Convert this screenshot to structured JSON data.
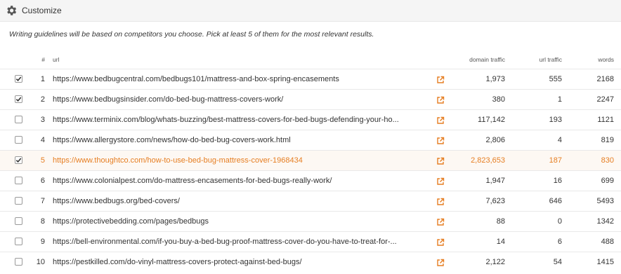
{
  "header": {
    "title": "Customize",
    "icon": "gear-icon"
  },
  "guideline": "Writing guidelines will be based on competitors you choose. Pick at least 5 of them for the most relevant results.",
  "columns": {
    "num": "#",
    "url": "url",
    "domain_traffic": "domain traffic",
    "url_traffic": "url traffic",
    "words": "words"
  },
  "accent_color": "#e67e22",
  "rows": [
    {
      "checked": true,
      "selected": false,
      "num": "1",
      "url": "https://www.bedbugcentral.com/bedbugs101/mattress-and-box-spring-encasements",
      "domain_traffic": "1,973",
      "url_traffic": "555",
      "words": "2168"
    },
    {
      "checked": true,
      "selected": false,
      "num": "2",
      "url": "https://www.bedbugsinsider.com/do-bed-bug-mattress-covers-work/",
      "domain_traffic": "380",
      "url_traffic": "1",
      "words": "2247"
    },
    {
      "checked": false,
      "selected": false,
      "num": "3",
      "url": "https://www.terminix.com/blog/whats-buzzing/best-mattress-covers-for-bed-bugs-defending-your-ho...",
      "domain_traffic": "117,142",
      "url_traffic": "193",
      "words": "1121"
    },
    {
      "checked": false,
      "selected": false,
      "num": "4",
      "url": "https://www.allergystore.com/news/how-do-bed-bug-covers-work.html",
      "domain_traffic": "2,806",
      "url_traffic": "4",
      "words": "819"
    },
    {
      "checked": true,
      "selected": true,
      "num": "5",
      "url": "https://www.thoughtco.com/how-to-use-bed-bug-mattress-cover-1968434",
      "domain_traffic": "2,823,653",
      "url_traffic": "187",
      "words": "830"
    },
    {
      "checked": false,
      "selected": false,
      "num": "6",
      "url": "https://www.colonialpest.com/do-mattress-encasements-for-bed-bugs-really-work/",
      "domain_traffic": "1,947",
      "url_traffic": "16",
      "words": "699"
    },
    {
      "checked": false,
      "selected": false,
      "num": "7",
      "url": "https://www.bedbugs.org/bed-covers/",
      "domain_traffic": "7,623",
      "url_traffic": "646",
      "words": "5493"
    },
    {
      "checked": false,
      "selected": false,
      "num": "8",
      "url": "https://protectivebedding.com/pages/bedbugs",
      "domain_traffic": "88",
      "url_traffic": "0",
      "words": "1342"
    },
    {
      "checked": false,
      "selected": false,
      "num": "9",
      "url": "https://bell-environmental.com/if-you-buy-a-bed-bug-proof-mattress-cover-do-you-have-to-treat-for-...",
      "domain_traffic": "14",
      "url_traffic": "6",
      "words": "488"
    },
    {
      "checked": false,
      "selected": false,
      "num": "10",
      "url": "https://pestkilled.com/do-vinyl-mattress-covers-protect-against-bed-bugs/",
      "domain_traffic": "2,122",
      "url_traffic": "54",
      "words": "1415"
    }
  ]
}
